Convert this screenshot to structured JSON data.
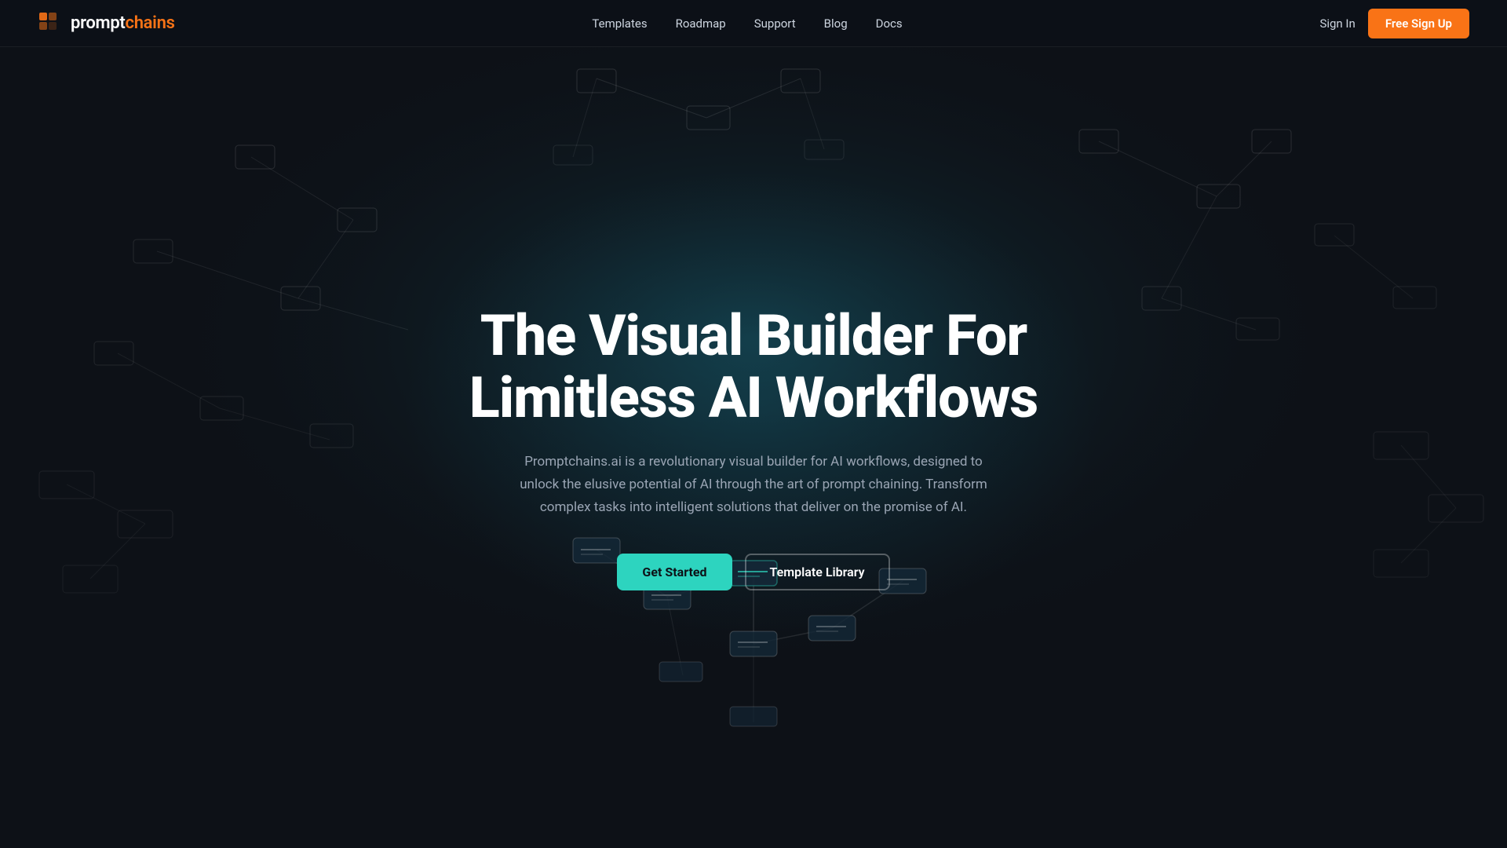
{
  "brand": {
    "logo_text_prompt": "prompt",
    "logo_text_chains": "chains",
    "logo_full": "promptchains"
  },
  "nav": {
    "links": [
      {
        "id": "templates",
        "label": "Templates",
        "href": "#"
      },
      {
        "id": "roadmap",
        "label": "Roadmap",
        "href": "#"
      },
      {
        "id": "support",
        "label": "Support",
        "href": "#"
      },
      {
        "id": "blog",
        "label": "Blog",
        "href": "#"
      },
      {
        "id": "docs",
        "label": "Docs",
        "href": "#"
      }
    ],
    "signin_label": "Sign In",
    "free_signup_label": "Free Sign Up"
  },
  "hero": {
    "title_line1": "The Visual Builder For",
    "title_line2": "Limitless AI Workflows",
    "subtitle": "Promptchains.ai is a revolutionary visual builder for AI workflows, designed to unlock the elusive potential of AI through the art of prompt chaining. Transform complex tasks into intelligent solutions that deliver on the promise of AI.",
    "cta_primary": "Get Started",
    "cta_secondary": "Template Library"
  },
  "colors": {
    "orange": "#f97316",
    "teal": "#2dd4bf",
    "bg": "#0d1117",
    "nav_text": "#cdd5e0",
    "body_text": "#9aa5b4"
  }
}
